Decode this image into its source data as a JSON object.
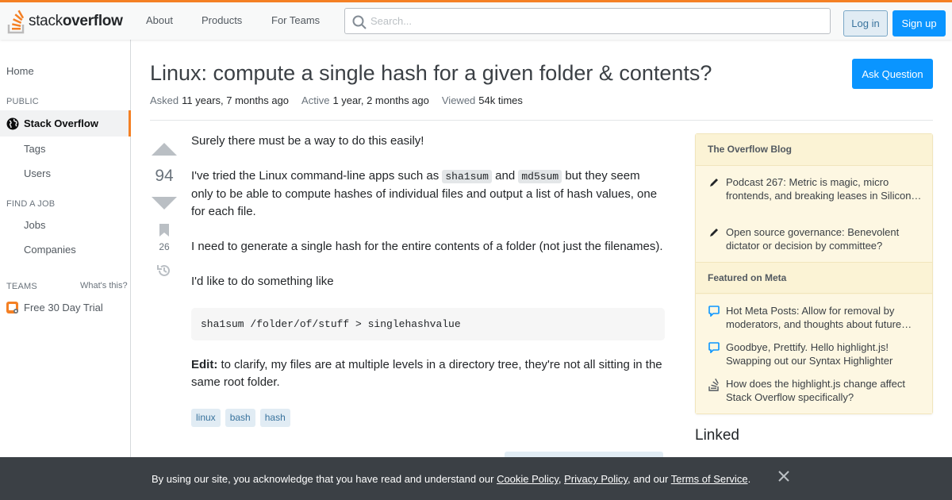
{
  "header": {
    "logo_prefix": "stack",
    "logo_bold": "overflow",
    "nav": [
      "About",
      "Products",
      "For Teams"
    ],
    "search_placeholder": "Search...",
    "login_label": "Log in",
    "signup_label": "Sign up",
    "accent_color": "#f48024"
  },
  "sidebar": {
    "home": "Home",
    "public_heading": "PUBLIC",
    "active_item": "Stack Overflow",
    "sub_items": [
      "Tags",
      "Users"
    ],
    "job_heading": "FIND A JOB",
    "job_items": [
      "Jobs",
      "Companies"
    ],
    "teams_heading": "TEAMS",
    "teams_link": "What's this?",
    "trial_label": "Free 30 Day Trial"
  },
  "question": {
    "title": "Linux: compute a single hash for a given folder & contents?",
    "ask_button": "Ask Question",
    "asked_label": "Asked",
    "asked_value": "11 years, 7 months ago",
    "active_label": "Active",
    "active_value": "1 year, 2 months ago",
    "viewed_label": "Viewed",
    "viewed_value": "54k times",
    "votes": "94",
    "bookmarks": "26",
    "body": {
      "p1": "Surely there must be a way to do this easily!",
      "p2_a": "I've tried the Linux command-line apps such as ",
      "p2_code1": "sha1sum",
      "p2_b": " and ",
      "p2_code2": "md5sum",
      "p2_c": " but they seem only to be able to compute hashes of individual files and output a list of hash values, one for each file.",
      "p3": "I need to generate a single hash for the entire contents of a folder (not just the filenames).",
      "p4": "I'd like to do something like",
      "code_block": "sha1sum /folder/of/stuff > singlehashvalue",
      "edit_label": "Edit:",
      "edit_text": " to clarify, my files are at multiple levels in a directory tree, they're not all sitting in the same root folder."
    },
    "tags": [
      "linux",
      "bash",
      "hash"
    ]
  },
  "right_sidebar": {
    "blog_heading": "The Overflow Blog",
    "blog_items": [
      "Podcast 267: Metric is magic, micro frontends, and breaking leases in Silicon…",
      "Open source governance: Benevolent dictator or decision by committee?"
    ],
    "meta_heading": "Featured on Meta",
    "meta_items": [
      "Hot Meta Posts: Allow for removal by moderators, and thoughts about future…",
      "Goodbye, Prettify. Hello highlight.js! Swapping out our Syntax Highlighter",
      "How does the highlight.js change affect Stack Overflow specifically?"
    ],
    "linked_heading": "Linked"
  },
  "cookie_banner": {
    "text_a": "By using our site, you acknowledge that you have read and understand our ",
    "cookie_policy": "Cookie Policy",
    "sep1": ", ",
    "privacy_policy": "Privacy Policy",
    "text_b": ", and our ",
    "terms": "Terms of Service",
    "text_c": "."
  }
}
